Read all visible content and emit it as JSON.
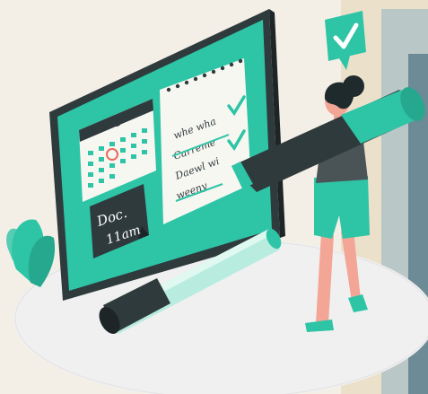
{
  "illustration": {
    "sticky_note": {
      "line1": "Doc.",
      "line2": "11am"
    },
    "checklist_scribbles": [
      "whe wha",
      "Carreme",
      "Daewl wi",
      "weeny"
    ],
    "colors": {
      "accent_teal": "#2ec4a6",
      "dark_slate": "#2f3a3c",
      "paper": "#f7f7f2",
      "skin": "#f3a596",
      "hair": "#1f2a2c",
      "floor": "#efefef"
    }
  }
}
